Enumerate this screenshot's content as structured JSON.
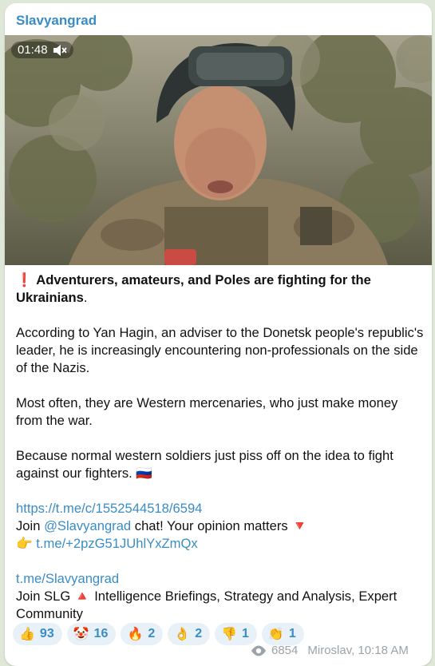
{
  "post": {
    "channel": "Slavyangrad",
    "video": {
      "duration": "01:48",
      "muted": true
    },
    "headline_mark": "❗",
    "headline_bold": "Adventurers, amateurs, and Poles are fighting for the Ukrainians",
    "headline_end": ".",
    "paragraph1": "According to Yan Hagin, an adviser to the Donetsk people's republic's leader, he is increasingly encountering non-professionals on the side of the Nazis.",
    "paragraph2": "Most often, they are Western mercenaries, who just make money from the war.",
    "paragraph3": "Because normal western soldiers just piss off on the idea to fight against our fighters.",
    "flag_emoji": "🇷🇺",
    "link1": "https://t.me/c/1552544518/6594",
    "join_prefix": "Join ",
    "join_mention": "@Slavyangrad",
    "join_suffix": " chat! Your opinion matters",
    "join_arrow": "🔻",
    "pointer_emoji": "👉",
    "invite_link": "t.me/+2pzG51JUhlYxZmQx",
    "channel_link": "t.me/Slavyangrad",
    "slg_prefix": "Join SLG",
    "slg_triangle": "🔺",
    "slg_text": "Intelligence Briefings, Strategy and Analysis, Expert Community"
  },
  "reactions": [
    {
      "emoji": "👍",
      "count": "93",
      "icon": "thumbs-up-icon"
    },
    {
      "emoji": "🤡",
      "count": "16",
      "icon": "clown-face-icon"
    },
    {
      "emoji": "🔥",
      "count": "2",
      "icon": "fire-icon"
    },
    {
      "emoji": "👌",
      "count": "2",
      "icon": "ok-hand-icon"
    },
    {
      "emoji": "👎",
      "count": "1",
      "icon": "thumbs-down-icon"
    },
    {
      "emoji": "👏",
      "count": "1",
      "icon": "clapping-hands-icon"
    }
  ],
  "meta": {
    "views": "6854",
    "author_time": "Miroslav, 10:18 AM"
  },
  "colors": {
    "link": "#3a8cc4",
    "background": "#dfe8d8",
    "reaction_bg": "#e8f1f8"
  }
}
